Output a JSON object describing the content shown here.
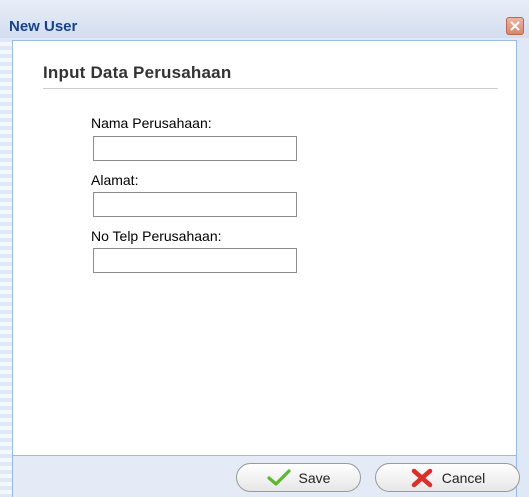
{
  "window": {
    "title": "New User",
    "close_icon": "close-icon"
  },
  "form": {
    "section_title": "Input Data Perusahaan",
    "fields": [
      {
        "label": "Nama Perusahaan:",
        "value": "",
        "placeholder": ""
      },
      {
        "label": "Alamat:",
        "value": "",
        "placeholder": ""
      },
      {
        "label": "No Telp Perusahaan:",
        "value": "",
        "placeholder": ""
      }
    ]
  },
  "footer": {
    "save_label": "Save",
    "save_icon": "checkmark-icon",
    "cancel_label": "Cancel",
    "cancel_icon": "cross-icon"
  },
  "colors": {
    "title_text": "#15428b",
    "window_bg": "#dfe8f6",
    "border": "#99bbe8",
    "save_icon": "#5cb82e",
    "cancel_icon": "#d8302a"
  }
}
